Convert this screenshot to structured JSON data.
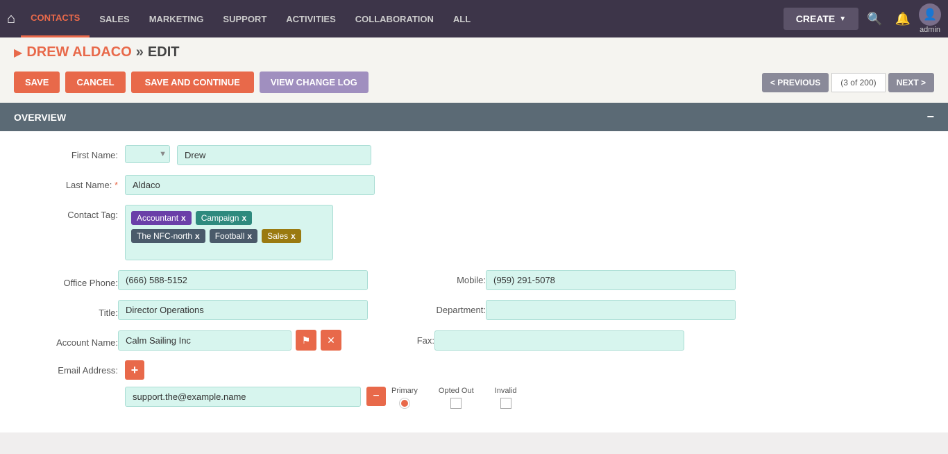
{
  "navbar": {
    "links": [
      {
        "id": "contacts",
        "label": "CONTACTS",
        "active": true
      },
      {
        "id": "sales",
        "label": "SALES",
        "active": false
      },
      {
        "id": "marketing",
        "label": "MARKETING",
        "active": false
      },
      {
        "id": "support",
        "label": "SUPPORT",
        "active": false
      },
      {
        "id": "activities",
        "label": "ACTIVITIES",
        "active": false
      },
      {
        "id": "collaboration",
        "label": "COLLABORATION",
        "active": false
      },
      {
        "id": "all",
        "label": "ALL",
        "active": false
      }
    ],
    "create_label": "CREATE",
    "admin_label": "admin"
  },
  "breadcrumb": {
    "name": "DREW ALDACO",
    "separator": "»",
    "action": "EDIT"
  },
  "toolbar": {
    "save_label": "SAVE",
    "cancel_label": "CANCEL",
    "save_continue_label": "SAVE AND CONTINUE",
    "view_log_label": "VIEW CHANGE LOG",
    "prev_label": "< PREVIOUS",
    "pagination": "(3 of 200)",
    "next_label": "NEXT >"
  },
  "overview": {
    "section_title": "OVERVIEW",
    "first_name_label": "First Name:",
    "first_name_title": "",
    "first_name_value": "Drew",
    "last_name_label": "Last Name:",
    "last_name_required": true,
    "last_name_value": "Aldaco",
    "contact_tag_label": "Contact Tag:",
    "tags": [
      {
        "label": "Accountant",
        "color": "purple"
      },
      {
        "label": "Campaign",
        "color": "teal"
      },
      {
        "label": "The NFC-north",
        "color": "darkgray"
      },
      {
        "label": "Football",
        "color": "darkgray"
      },
      {
        "label": "Sales",
        "color": "gold"
      }
    ],
    "office_phone_label": "Office Phone:",
    "office_phone_value": "(666) 588-5152",
    "mobile_label": "Mobile:",
    "mobile_value": "(959) 291-5078",
    "title_label": "Title:",
    "title_value": "Director Operations",
    "department_label": "Department:",
    "department_value": "",
    "account_name_label": "Account Name:",
    "account_name_value": "Calm Sailing Inc",
    "fax_label": "Fax:",
    "fax_value": "",
    "email_label": "Email Address:",
    "email_value": "support.the@example.name",
    "email_primary_label": "Primary",
    "email_opted_out_label": "Opted Out",
    "email_invalid_label": "Invalid"
  }
}
